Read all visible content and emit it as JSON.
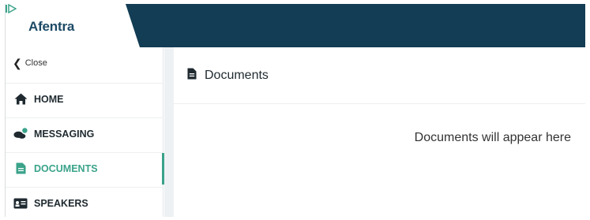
{
  "brand": {
    "name": "Afentra",
    "color": "#123d54",
    "accent": "#3aa38a"
  },
  "sidebar": {
    "close_label": "Close",
    "items": [
      {
        "label": "HOME",
        "icon": "home-icon",
        "active": false
      },
      {
        "label": "MESSAGING",
        "icon": "chat-icon",
        "active": false
      },
      {
        "label": "DOCUMENTS",
        "icon": "document-icon",
        "active": true
      },
      {
        "label": "SPEAKERS",
        "icon": "id-card-icon",
        "active": false
      }
    ]
  },
  "main": {
    "title": "Documents",
    "empty_message": "Documents will appear here"
  }
}
